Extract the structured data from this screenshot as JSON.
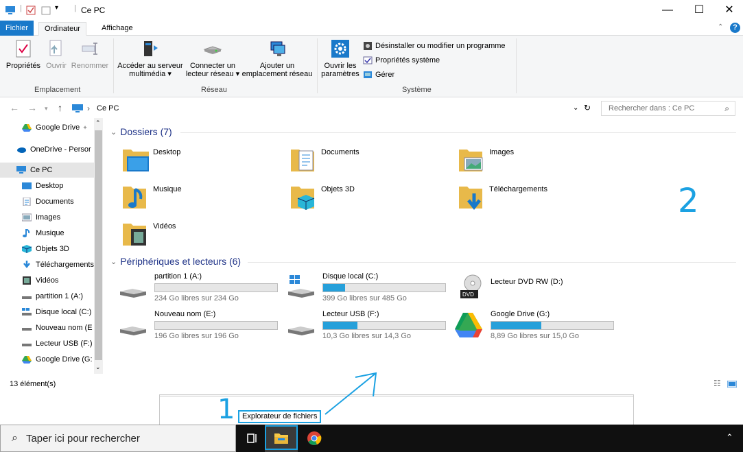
{
  "window": {
    "title": "Ce PC",
    "minimize": "—",
    "maximize": "☐",
    "close": "✕"
  },
  "ribbon": {
    "tabs": [
      "Fichier",
      "Ordinateur",
      "Affichage"
    ],
    "active_tab": "Ordinateur",
    "groups": {
      "emplacement": {
        "label": "Emplacement",
        "buttons": [
          "Propriétés",
          "Ouvrir",
          "Renommer"
        ]
      },
      "reseau": {
        "label": "Réseau",
        "buttons": [
          {
            "line1": "Accéder au serveur",
            "line2": "multimédia ▾"
          },
          {
            "line1": "Connecter un",
            "line2": "lecteur réseau ▾"
          },
          {
            "line1": "Ajouter un",
            "line2": "emplacement réseau"
          }
        ]
      },
      "systeme": {
        "label": "Système",
        "open_settings": {
          "line1": "Ouvrir les",
          "line2": "paramètres"
        },
        "commands": [
          "Désinstaller ou modifier un programme",
          "Propriétés système",
          "Gérer"
        ]
      }
    }
  },
  "address": {
    "path": "Ce PC",
    "search_placeholder": "Rechercher dans : Ce PC"
  },
  "navpane": {
    "items": [
      {
        "label": "Google Drive",
        "icon": "google-drive-icon"
      },
      {
        "label": "OneDrive - Persor",
        "icon": "onedrive-icon"
      },
      {
        "label": "Ce PC",
        "icon": "pc-icon"
      },
      {
        "label": "Desktop",
        "icon": "desktop-icon"
      },
      {
        "label": "Documents",
        "icon": "documents-icon"
      },
      {
        "label": "Images",
        "icon": "images-icon"
      },
      {
        "label": "Musique",
        "icon": "music-icon"
      },
      {
        "label": "Objets 3D",
        "icon": "objects3d-icon"
      },
      {
        "label": "Téléchargements",
        "icon": "downloads-icon"
      },
      {
        "label": "Vidéos",
        "icon": "videos-icon"
      },
      {
        "label": "partition 1 (A:)",
        "icon": "drive-icon"
      },
      {
        "label": "Disque local (C:)",
        "icon": "windows-drive-icon"
      },
      {
        "label": "Nouveau nom (E",
        "icon": "drive-icon"
      },
      {
        "label": "Lecteur USB (F:)",
        "icon": "drive-icon"
      },
      {
        "label": "Google Drive (G:",
        "icon": "google-drive-icon"
      }
    ]
  },
  "content": {
    "folders_header": "Dossiers (7)",
    "folders": [
      "Desktop",
      "Documents",
      "Images",
      "Musique",
      "Objets 3D",
      "Téléchargements",
      "Vidéos"
    ],
    "devices_header": "Périphériques et lecteurs (6)",
    "drives": [
      {
        "name": "partition 1 (A:)",
        "free": "234 Go libres sur 234 Go",
        "used_fraction": 0.0
      },
      {
        "name": "Disque local (C:)",
        "free": "399 Go libres sur 485 Go",
        "used_fraction": 0.18
      },
      {
        "name": "Lecteur DVD RW (D:)",
        "free": "",
        "used_fraction": null
      },
      {
        "name": "Nouveau nom (E:)",
        "free": "196 Go libres sur 196 Go",
        "used_fraction": 0.0
      },
      {
        "name": "Lecteur USB (F:)",
        "free": "10,3 Go libres sur 14,3 Go",
        "used_fraction": 0.28
      },
      {
        "name": "Google Drive (G:)",
        "free": "8,89 Go libres sur 15,0 Go",
        "used_fraction": 0.41
      }
    ]
  },
  "status": {
    "count": "13 élément(s)"
  },
  "taskbar": {
    "search_placeholder": "Taper ici pour rechercher"
  },
  "annotations": {
    "tooltip": "Explorateur de fichiers",
    "marker1": "1",
    "marker2": "2"
  },
  "colors": {
    "accent": "#1979ca",
    "annotation": "#1ba1e2",
    "bar_fill": "#26a0da"
  }
}
